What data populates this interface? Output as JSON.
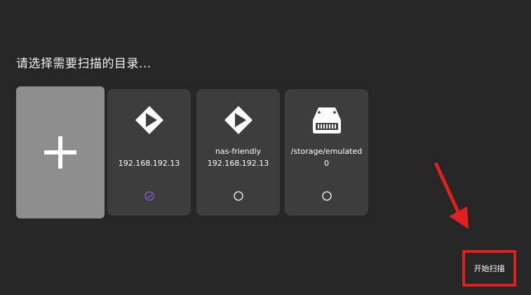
{
  "title": "请选择需要扫描的目录...",
  "add_card": {
    "icon": "plus-icon"
  },
  "directories": [
    {
      "icon": "emby-server-icon",
      "line1": "",
      "line2": "192.168.192.13",
      "selected": true
    },
    {
      "icon": "emby-server-icon",
      "line1": "nas-friendly",
      "line2": "192.168.192.13",
      "selected": false
    },
    {
      "icon": "hard-drive-icon",
      "line1": "/storage/emulated",
      "line2": "0",
      "selected": false
    }
  ],
  "start_button": {
    "label": "开始扫描"
  },
  "colors": {
    "background": "#262626",
    "card": "#3d3d3d",
    "add_card": "#8e8e8e",
    "selected_check": "#8a5cd6",
    "annotation_red": "#e02020"
  }
}
